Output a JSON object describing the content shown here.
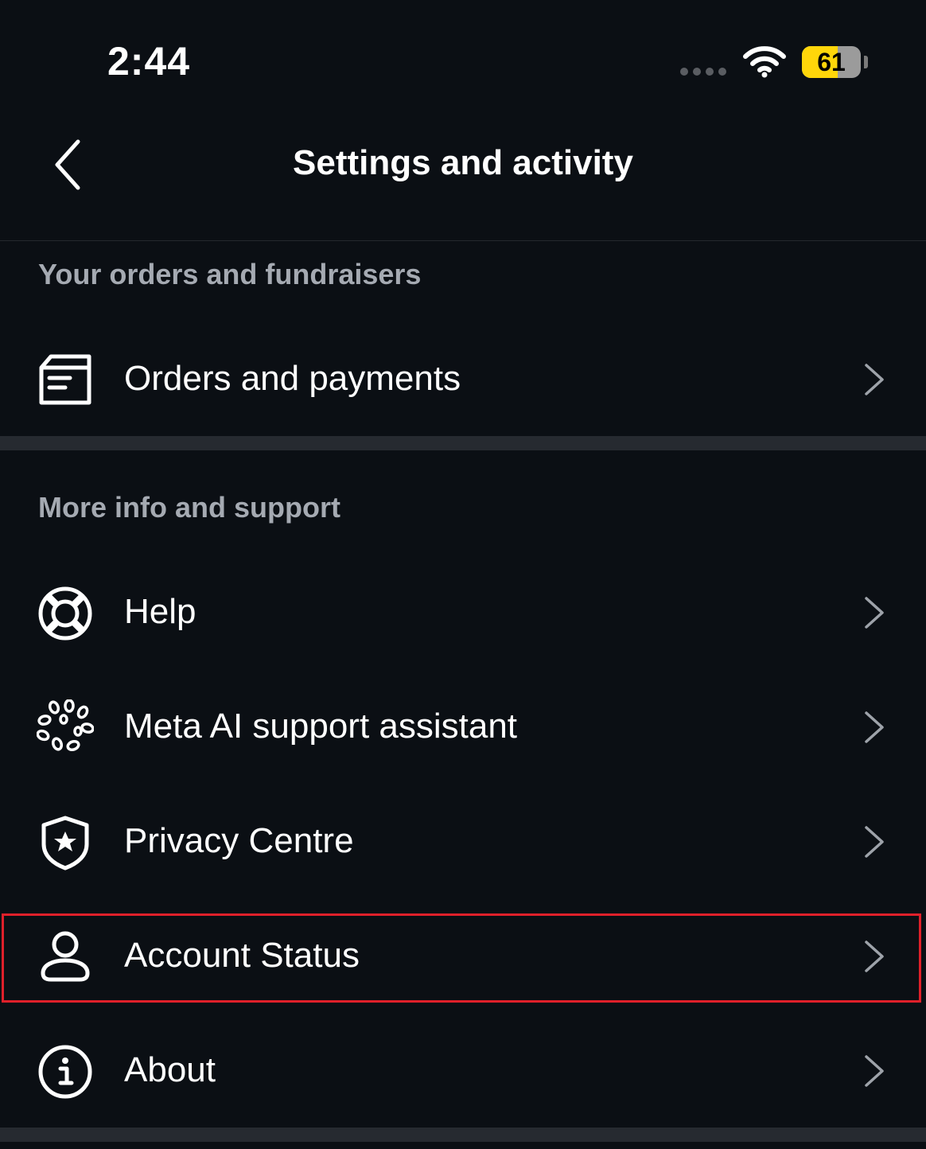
{
  "status_bar": {
    "time": "2:44",
    "battery_level": "61",
    "battery_fraction": 0.61
  },
  "header": {
    "back_icon": "chevron-left-icon",
    "title": "Settings and activity"
  },
  "sections": [
    {
      "header": "Your orders and fundraisers",
      "items": [
        {
          "label": "Orders and payments",
          "icon": "receipt-box-icon"
        }
      ]
    },
    {
      "header": "More info and support",
      "items": [
        {
          "label": "Help",
          "icon": "lifebuoy-icon"
        },
        {
          "label": "Meta AI support assistant",
          "icon": "meta-ai-icon"
        },
        {
          "label": "Privacy Centre",
          "icon": "shield-star-icon"
        },
        {
          "label": "Account Status",
          "icon": "person-icon",
          "highlighted": true
        },
        {
          "label": "About",
          "icon": "info-icon"
        }
      ]
    }
  ],
  "colors": {
    "background": "#0b0f14",
    "section_header": "#a5aab2",
    "separator": "#262a30",
    "highlight": "#e0202a",
    "battery": "#ffd60a"
  }
}
